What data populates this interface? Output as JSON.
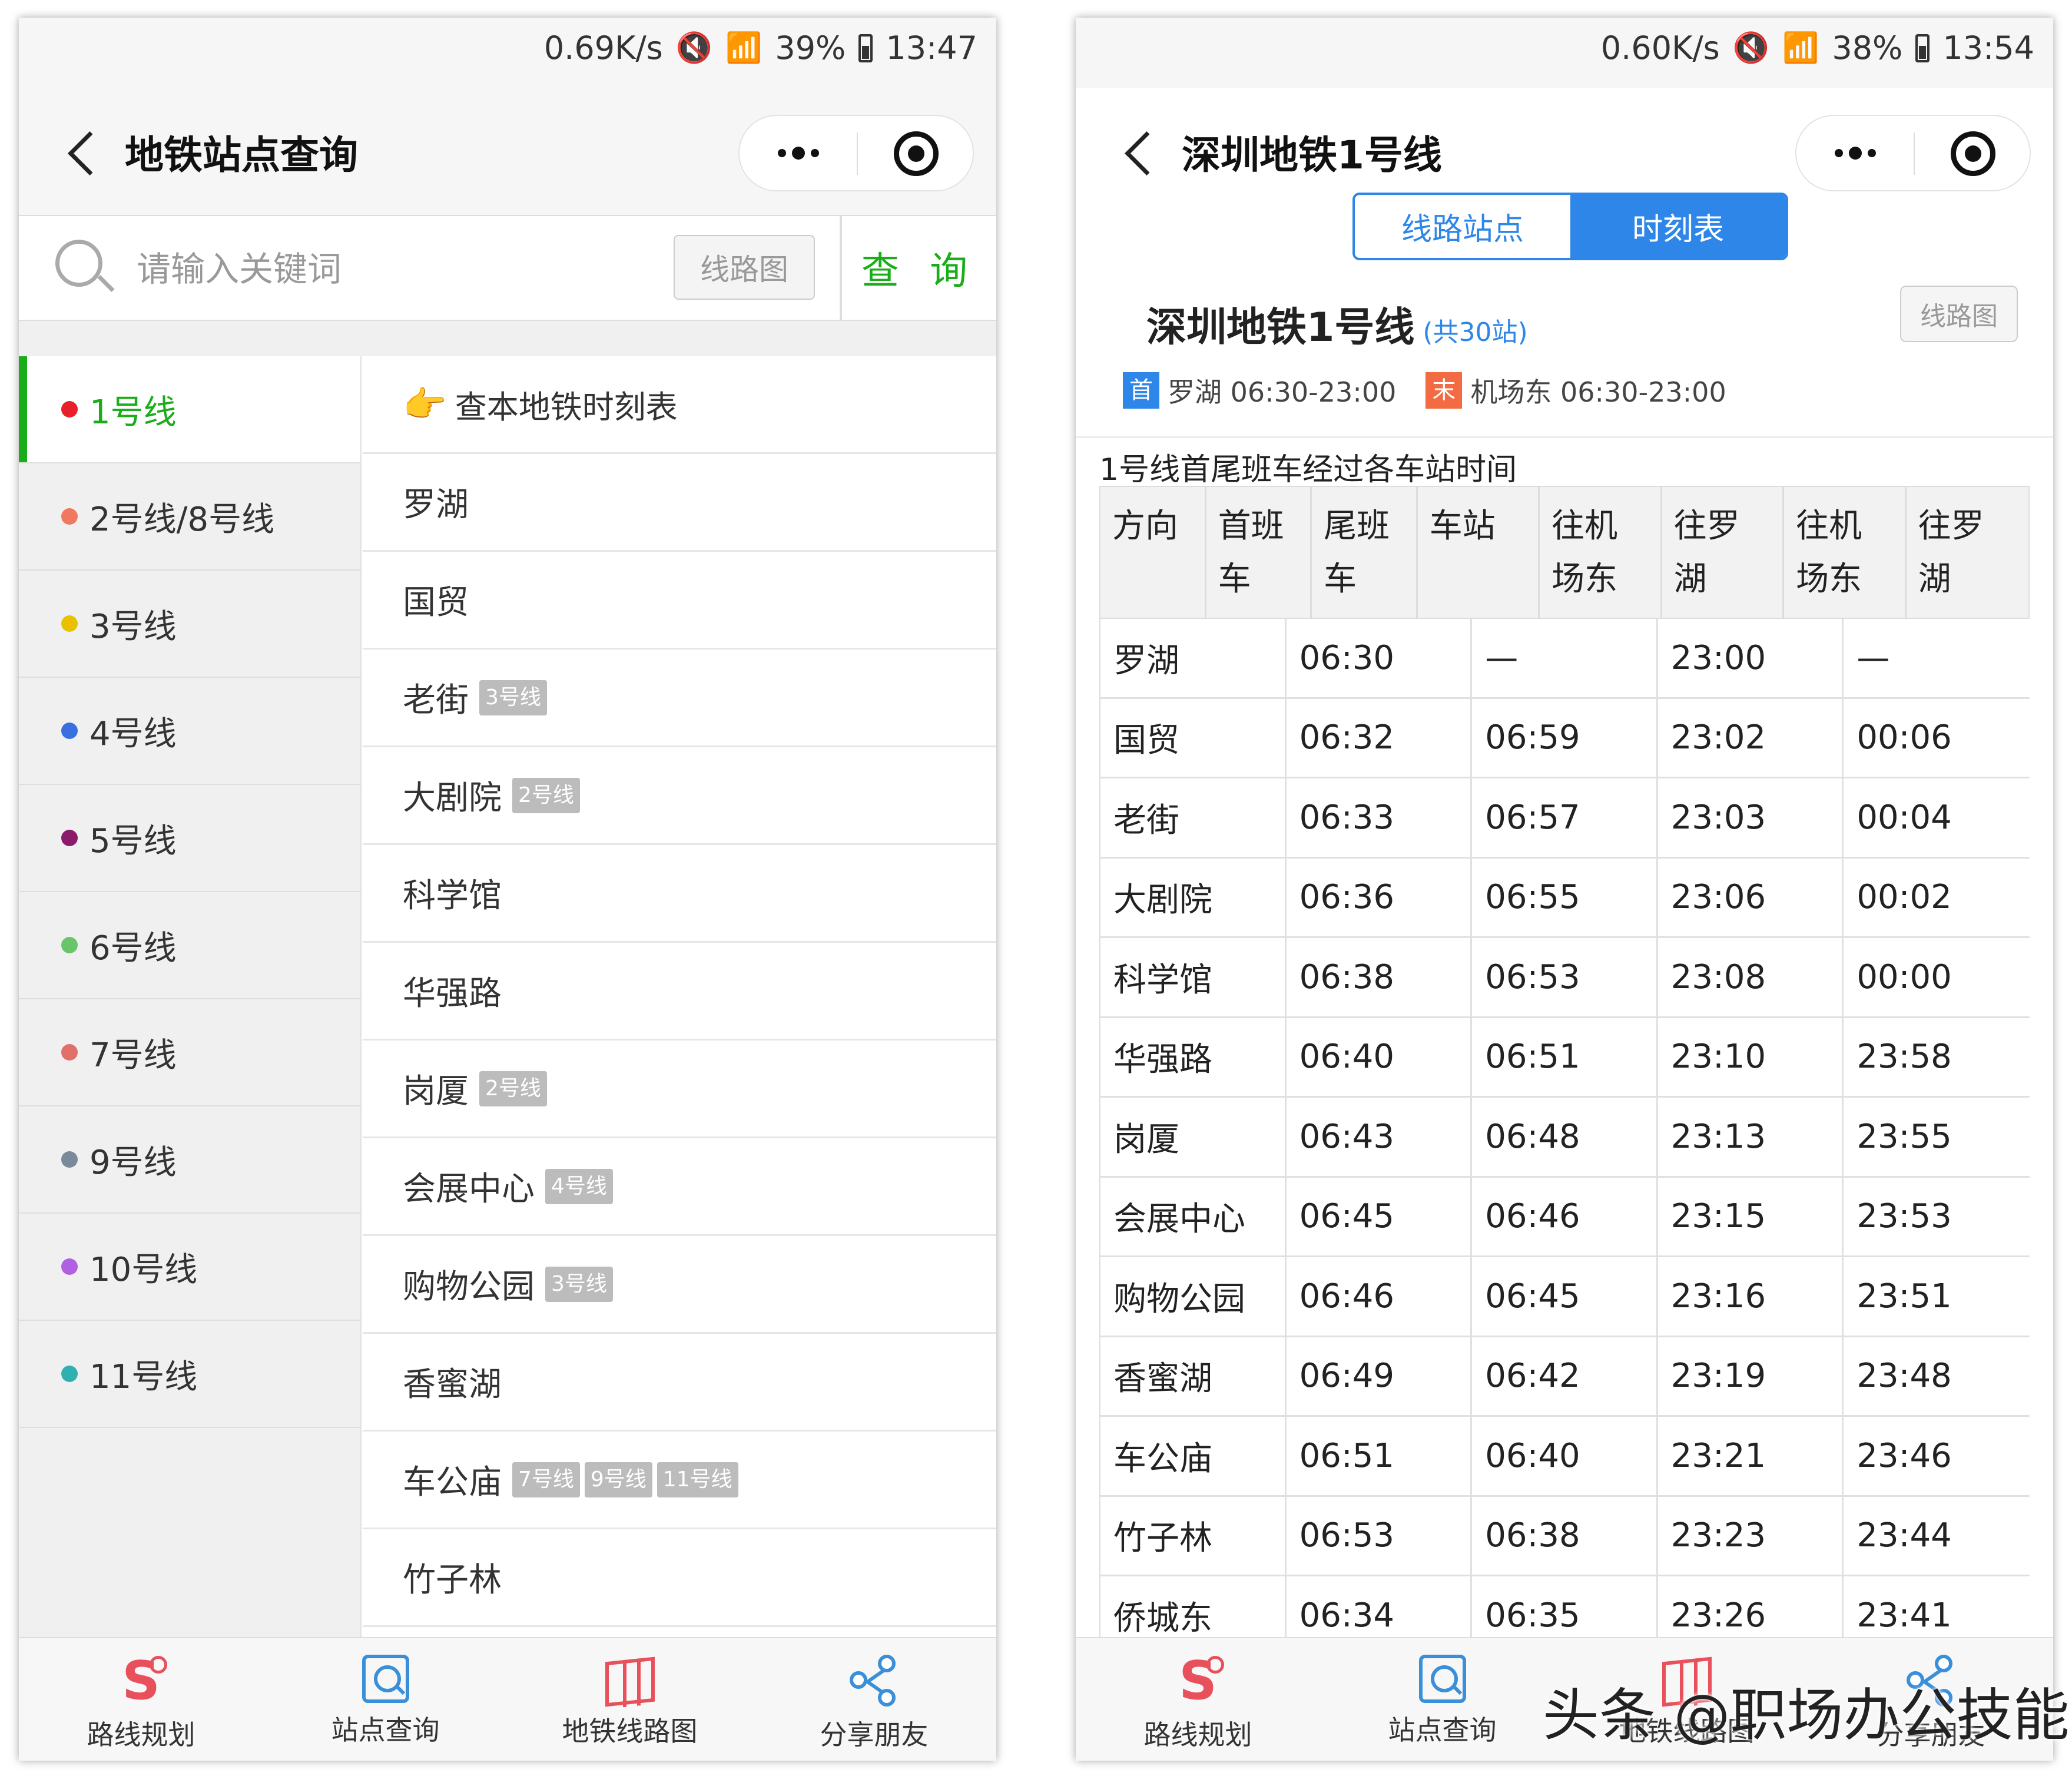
{
  "left": {
    "status": {
      "speed": "0.69K/s",
      "battery": "39%",
      "time": "13:47"
    },
    "title": "地铁站点查询",
    "search": {
      "placeholder": "请输入关键词",
      "map_button": "线路图",
      "query_button": "查 询"
    },
    "lines": [
      {
        "label": "1号线",
        "color": "#e8202a",
        "active": true
      },
      {
        "label": "2号线/8号线",
        "color": "#f07860"
      },
      {
        "label": "3号线",
        "color": "#e8c200"
      },
      {
        "label": "4号线",
        "color": "#3a6fe0"
      },
      {
        "label": "5号线",
        "color": "#8a1a6a"
      },
      {
        "label": "6号线",
        "color": "#6ac46a"
      },
      {
        "label": "7号线",
        "color": "#e0706a"
      },
      {
        "label": "9号线",
        "color": "#7a8a9a"
      },
      {
        "label": "10号线",
        "color": "#b060e0"
      },
      {
        "label": "11号线",
        "color": "#30b0b0"
      }
    ],
    "timetable_link": "查本地铁时刻表",
    "stations": [
      {
        "name": "罗湖",
        "tags": []
      },
      {
        "name": "国贸",
        "tags": []
      },
      {
        "name": "老街",
        "tags": [
          "3号线"
        ]
      },
      {
        "name": "大剧院",
        "tags": [
          "2号线"
        ]
      },
      {
        "name": "科学馆",
        "tags": []
      },
      {
        "name": "华强路",
        "tags": []
      },
      {
        "name": "岗厦",
        "tags": [
          "2号线"
        ]
      },
      {
        "name": "会展中心",
        "tags": [
          "4号线"
        ]
      },
      {
        "name": "购物公园",
        "tags": [
          "3号线"
        ]
      },
      {
        "name": "香蜜湖",
        "tags": []
      },
      {
        "name": "车公庙",
        "tags": [
          "7号线",
          "9号线",
          "11号线"
        ]
      },
      {
        "name": "竹子林",
        "tags": []
      }
    ]
  },
  "right": {
    "status": {
      "speed": "0.60K/s",
      "battery": "38%",
      "time": "13:54"
    },
    "title": "深圳地铁1号线",
    "tabs": {
      "stations": "线路站点",
      "timetable": "时刻表"
    },
    "line_title": "深圳地铁1号线",
    "station_count": "(共30站)",
    "map_button": "线路图",
    "first_badge": "首",
    "first_info": "罗湖 06:30-23:00",
    "last_badge": "末",
    "last_info": "机场东 06:30-23:00",
    "table_caption": "1号线首尾班车经过各车站时间",
    "headers": {
      "direction": "方向",
      "first_train": "首班车",
      "last_train": "尾班车",
      "station": "车站",
      "to_airport_1": "往机场东",
      "to_luohu_1": "往罗湖",
      "to_airport_2": "往机场东",
      "to_luohu_2": "往罗湖"
    },
    "rows": [
      [
        "罗湖",
        "06:30",
        "—",
        "23:00",
        "—"
      ],
      [
        "国贸",
        "06:32",
        "06:59",
        "23:02",
        "00:06"
      ],
      [
        "老街",
        "06:33",
        "06:57",
        "23:03",
        "00:04"
      ],
      [
        "大剧院",
        "06:36",
        "06:55",
        "23:06",
        "00:02"
      ],
      [
        "科学馆",
        "06:38",
        "06:53",
        "23:08",
        "00:00"
      ],
      [
        "华强路",
        "06:40",
        "06:51",
        "23:10",
        "23:58"
      ],
      [
        "岗厦",
        "06:43",
        "06:48",
        "23:13",
        "23:55"
      ],
      [
        "会展中心",
        "06:45",
        "06:46",
        "23:15",
        "23:53"
      ],
      [
        "购物公园",
        "06:46",
        "06:45",
        "23:16",
        "23:51"
      ],
      [
        "香蜜湖",
        "06:49",
        "06:42",
        "23:19",
        "23:48"
      ],
      [
        "车公庙",
        "06:51",
        "06:40",
        "23:21",
        "23:46"
      ],
      [
        "竹子林",
        "06:53",
        "06:38",
        "23:23",
        "23:44"
      ],
      [
        "侨城东",
        "06:34",
        "06:35",
        "23:26",
        "23:41"
      ]
    ]
  },
  "tabbar": {
    "route": "路线规划",
    "station_search": "站点查询",
    "metro_map": "地铁线路图",
    "share": "分享朋友"
  },
  "watermark": "头条 @职场办公技能",
  "colors": {
    "green": "#1aad19",
    "blue": "#2d86e8",
    "red": "#e8505b",
    "orange": "#f36b43"
  }
}
